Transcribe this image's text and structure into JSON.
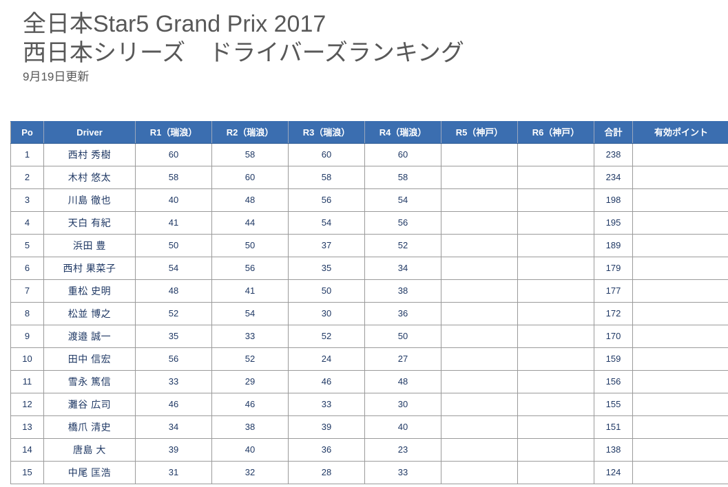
{
  "heading": {
    "title_line1": "全日本Star5 Grand Prix 2017",
    "title_line2": "西日本シリーズ　ドライバーズランキング",
    "subtitle": "9月19日更新"
  },
  "colors": {
    "header_blue": "#3B6EB0",
    "header_text": "#FFFFFF",
    "cell_text": "#1F3864",
    "title_text": "#585858",
    "grid_line": "#9A9A9A",
    "page_background": "#FFFFFF"
  },
  "table": {
    "columns": [
      "Po",
      "Driver",
      "R1（瑞浪）",
      "R2（瑞浪）",
      "R3（瑞浪）",
      "R4（瑞浪）",
      "R5（神戸）",
      "R6（神戸）",
      "合計",
      "有効ポイント"
    ],
    "rows": [
      {
        "po": "1",
        "driver": "西村 秀樹",
        "r1": "60",
        "r2": "58",
        "r3": "60",
        "r4": "60",
        "r5": "",
        "r6": "",
        "total": "238",
        "effective": ""
      },
      {
        "po": "2",
        "driver": "木村 悠太",
        "r1": "58",
        "r2": "60",
        "r3": "58",
        "r4": "58",
        "r5": "",
        "r6": "",
        "total": "234",
        "effective": ""
      },
      {
        "po": "3",
        "driver": "川島 徹也",
        "r1": "40",
        "r2": "48",
        "r3": "56",
        "r4": "54",
        "r5": "",
        "r6": "",
        "total": "198",
        "effective": ""
      },
      {
        "po": "4",
        "driver": "天白 有紀",
        "r1": "41",
        "r2": "44",
        "r3": "54",
        "r4": "56",
        "r5": "",
        "r6": "",
        "total": "195",
        "effective": ""
      },
      {
        "po": "5",
        "driver": "浜田 豊",
        "r1": "50",
        "r2": "50",
        "r3": "37",
        "r4": "52",
        "r5": "",
        "r6": "",
        "total": "189",
        "effective": ""
      },
      {
        "po": "6",
        "driver": "西村 果菜子",
        "r1": "54",
        "r2": "56",
        "r3": "35",
        "r4": "34",
        "r5": "",
        "r6": "",
        "total": "179",
        "effective": ""
      },
      {
        "po": "7",
        "driver": "重松 史明",
        "r1": "48",
        "r2": "41",
        "r3": "50",
        "r4": "38",
        "r5": "",
        "r6": "",
        "total": "177",
        "effective": ""
      },
      {
        "po": "8",
        "driver": "松並 博之",
        "r1": "52",
        "r2": "54",
        "r3": "30",
        "r4": "36",
        "r5": "",
        "r6": "",
        "total": "172",
        "effective": ""
      },
      {
        "po": "9",
        "driver": "渡邉 誠一",
        "r1": "35",
        "r2": "33",
        "r3": "52",
        "r4": "50",
        "r5": "",
        "r6": "",
        "total": "170",
        "effective": ""
      },
      {
        "po": "10",
        "driver": "田中 信宏",
        "r1": "56",
        "r2": "52",
        "r3": "24",
        "r4": "27",
        "r5": "",
        "r6": "",
        "total": "159",
        "effective": ""
      },
      {
        "po": "11",
        "driver": "雪永 篤信",
        "r1": "33",
        "r2": "29",
        "r3": "46",
        "r4": "48",
        "r5": "",
        "r6": "",
        "total": "156",
        "effective": ""
      },
      {
        "po": "12",
        "driver": "灘谷 広司",
        "r1": "46",
        "r2": "46",
        "r3": "33",
        "r4": "30",
        "r5": "",
        "r6": "",
        "total": "155",
        "effective": ""
      },
      {
        "po": "13",
        "driver": "橋爪 清史",
        "r1": "34",
        "r2": "38",
        "r3": "39",
        "r4": "40",
        "r5": "",
        "r6": "",
        "total": "151",
        "effective": ""
      },
      {
        "po": "14",
        "driver": "唐島 大",
        "r1": "39",
        "r2": "40",
        "r3": "36",
        "r4": "23",
        "r5": "",
        "r6": "",
        "total": "138",
        "effective": ""
      },
      {
        "po": "15",
        "driver": "中尾 匡浩",
        "r1": "31",
        "r2": "32",
        "r3": "28",
        "r4": "33",
        "r5": "",
        "r6": "",
        "total": "124",
        "effective": ""
      }
    ]
  }
}
